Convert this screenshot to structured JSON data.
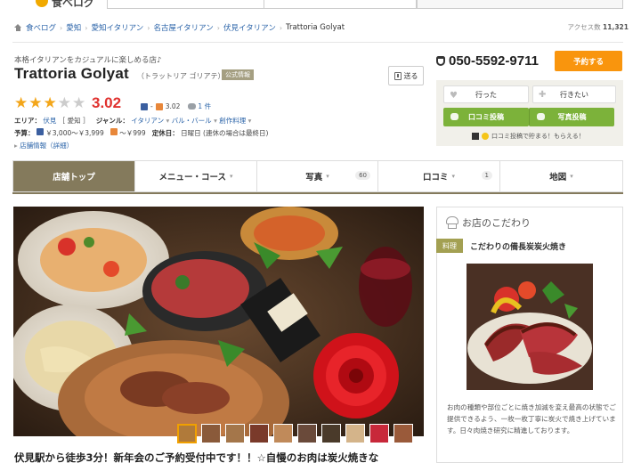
{
  "header": {
    "logo_text": "食べログ"
  },
  "breadcrumb": {
    "items": [
      "食べログ",
      "愛知",
      "愛知イタリアン",
      "名古屋イタリアン",
      "伏見イタリアン",
      "Trattoria Golyat"
    ],
    "access_label": "アクセス数",
    "access_count": "11,321"
  },
  "restaurant": {
    "catch": "本格イタリアンをカジュアルに楽しめる店♪",
    "name": "Trattoria Golyat",
    "kana": "（トラットリア ゴリアテ）",
    "official_badge": "公式情報",
    "send_label": "送る",
    "rating": "3.02",
    "rating_stars": 3,
    "rating_max": 5,
    "night_score": "-",
    "lunch_score": "3.02",
    "review_count": "1 件",
    "area_label": "エリア：",
    "area_value": "伏見",
    "area_pref": "［ 愛知 ］",
    "genre_label": "ジャンル：",
    "genre_values": [
      "イタリアン",
      "バル・バール",
      "創作料理"
    ],
    "budget_label": "予算：",
    "budget_night": "￥3,000～￥3,999",
    "budget_lunch": "～￥999",
    "holiday_label": "定休日：",
    "holiday_value": "日曜日 (連休の場合は最終日)",
    "shop_info_link": "店舗情報（詳細）"
  },
  "actions": {
    "phone": "050-5592-9711",
    "reserve": "予約する",
    "went": "行った",
    "want": "行きたい",
    "review_post": "口コミ投稿",
    "photo_post": "写真投稿",
    "promo": "口コミ投稿で貯まる！もらえる！"
  },
  "tabs": [
    {
      "label": "店舗トップ",
      "count": ""
    },
    {
      "label": "メニュー・コース",
      "count": ""
    },
    {
      "label": "写真",
      "count": "60"
    },
    {
      "label": "口コミ",
      "count": "1"
    },
    {
      "label": "地図",
      "count": ""
    }
  ],
  "main": {
    "headline": "伏見駅から徒歩3分！新年会のご予約受付中です！！☆自慢のお肉は炭火焼きな"
  },
  "kodawari": {
    "title": "お店のこだわり",
    "tag": "料理",
    "subtitle": "こだわりの備長炭炭火焼き",
    "text": "お肉の種類や部位ごとに焼き加減を変え最高の状態でご提供できるよう、一枚一枚丁寧に炭火で焼き上げています。日々肉焼き研究に精進しております。"
  },
  "colors": {
    "accent_orange": "#f9950d",
    "rating_red": "#e0322f",
    "star_orange": "#f3a61a",
    "tab_active": "#847a5c",
    "green": "#7cb23a",
    "link_blue": "#2a63a8"
  }
}
